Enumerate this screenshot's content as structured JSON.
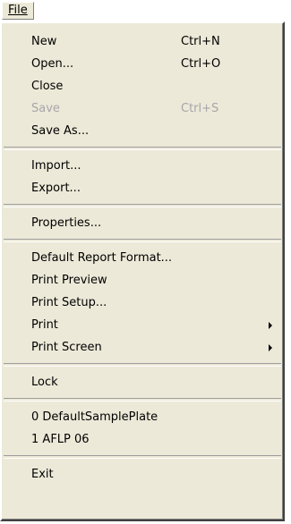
{
  "menubar": {
    "title": "File"
  },
  "menu": {
    "items": {
      "new": {
        "label": "New",
        "shortcut": "Ctrl+N"
      },
      "open": {
        "label": "Open...",
        "shortcut": "Ctrl+O"
      },
      "close": {
        "label": "Close"
      },
      "save": {
        "label": "Save",
        "shortcut": "Ctrl+S",
        "disabled": true
      },
      "save_as": {
        "label": "Save As..."
      },
      "import": {
        "label": "Import..."
      },
      "export": {
        "label": "Export..."
      },
      "properties": {
        "label": "Properties..."
      },
      "default_report_format": {
        "label": "Default Report Format..."
      },
      "print_preview": {
        "label": "Print Preview"
      },
      "print_setup": {
        "label": "Print Setup..."
      },
      "print": {
        "label": "Print",
        "has_submenu": true
      },
      "print_screen": {
        "label": "Print Screen",
        "has_submenu": true
      },
      "lock": {
        "label": "Lock"
      },
      "recent_0": {
        "index": "0",
        "name": "DefaultSamplePlate"
      },
      "recent_1": {
        "index": "1",
        "name": "AFLP 06"
      },
      "exit": {
        "label": "Exit"
      }
    }
  },
  "colors": {
    "menu_bg": "#ece9d8",
    "disabled_text": "#a7a6aa"
  }
}
